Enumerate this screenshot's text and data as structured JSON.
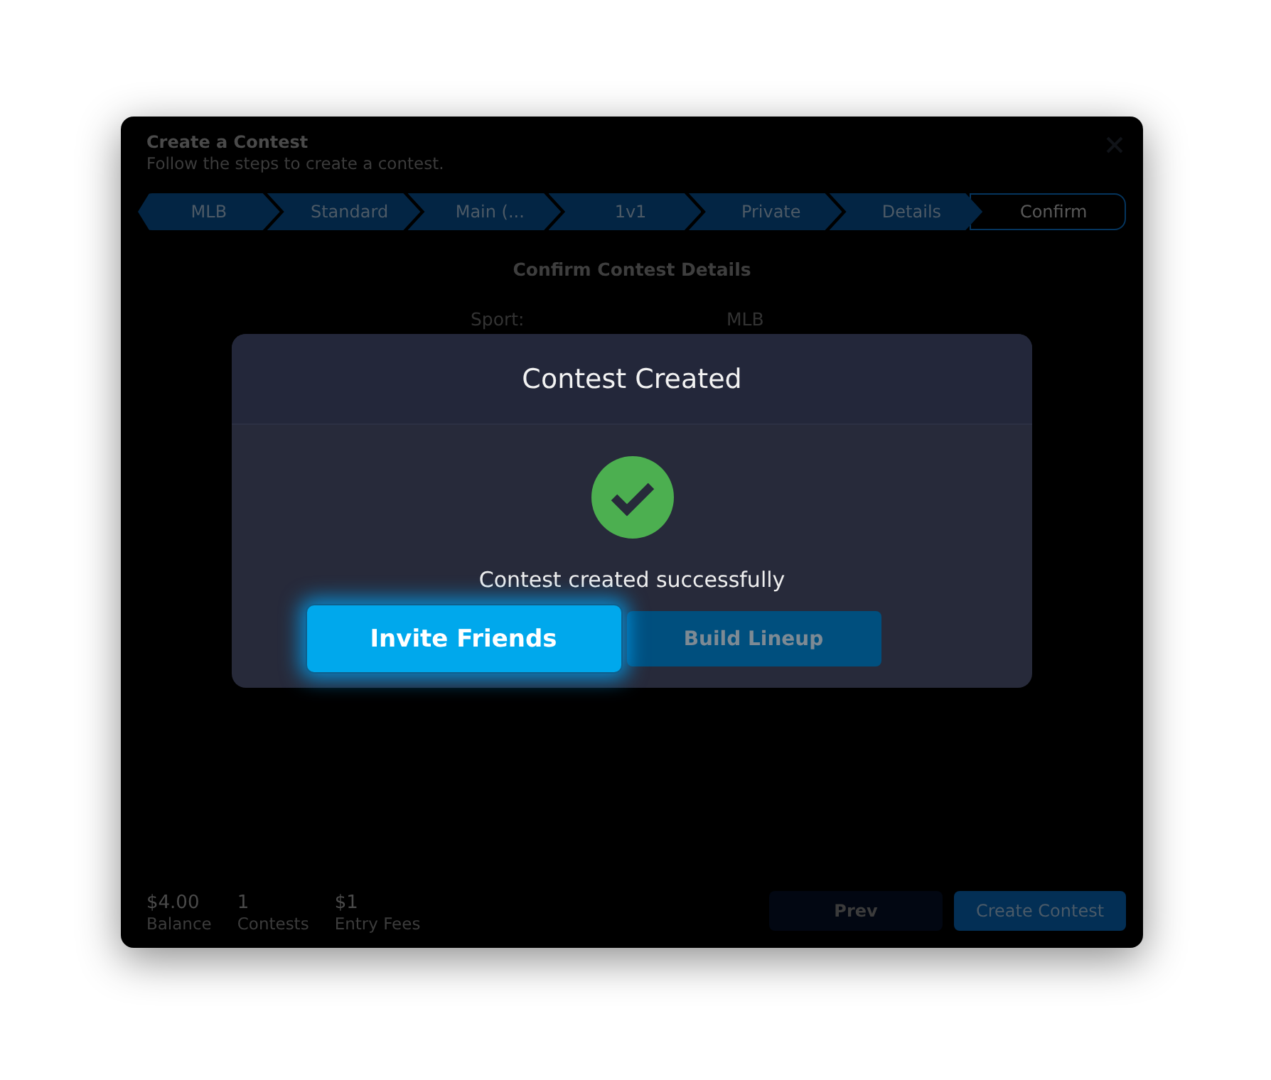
{
  "window": {
    "title": "Create a Contest",
    "subtitle": "Follow the steps to create a contest."
  },
  "steps": [
    {
      "label": "MLB",
      "selected": false
    },
    {
      "label": "Standard",
      "selected": false
    },
    {
      "label": "Main (...",
      "selected": false
    },
    {
      "label": "1v1",
      "selected": false
    },
    {
      "label": "Private",
      "selected": false
    },
    {
      "label": "Details",
      "selected": false
    },
    {
      "label": "Confirm",
      "selected": true
    }
  ],
  "section": {
    "heading": "Confirm Contest Details",
    "rows": [
      {
        "label": "Sport:",
        "value": "MLB"
      }
    ]
  },
  "footer": {
    "stats": [
      {
        "value": "$4.00",
        "label": "Balance"
      },
      {
        "value": "1",
        "label": "Contests"
      },
      {
        "value": "$1",
        "label": "Entry Fees"
      }
    ],
    "buttons": [
      {
        "label": "Prev",
        "kind": "secondary"
      },
      {
        "label": "Create Contest",
        "kind": "primary"
      }
    ]
  },
  "dialog": {
    "title": "Contest Created",
    "message": "Contest created successfully",
    "buttons": [
      {
        "label": "Invite Friends",
        "kind": "primary"
      },
      {
        "label": "Build Lineup",
        "kind": "secondary"
      }
    ]
  }
}
